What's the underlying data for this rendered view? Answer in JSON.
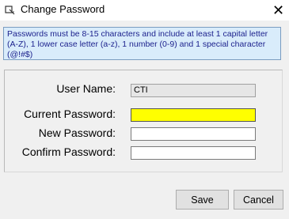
{
  "window": {
    "title": "Change Password",
    "close_glyph": "✕"
  },
  "info": {
    "message": "Passwords must be 8-15 characters and include at least 1 capital letter (A-Z), 1 lower case letter (a-z), 1 number (0-9) and 1 special character (@!#$)"
  },
  "form": {
    "username_label": "User Name:",
    "username_value": "CTI",
    "current_label": "Current Password:",
    "new_label": "New Password:",
    "confirm_label": "Confirm Password:"
  },
  "buttons": {
    "save_label": "Save",
    "cancel_label": "Cancel"
  },
  "colors": {
    "focus_field": "#ffff00",
    "info_bg": "#d9ecfb",
    "info_text": "#1a1f8c"
  },
  "icons": {
    "app": "key-window-icon",
    "close": "close-icon"
  }
}
